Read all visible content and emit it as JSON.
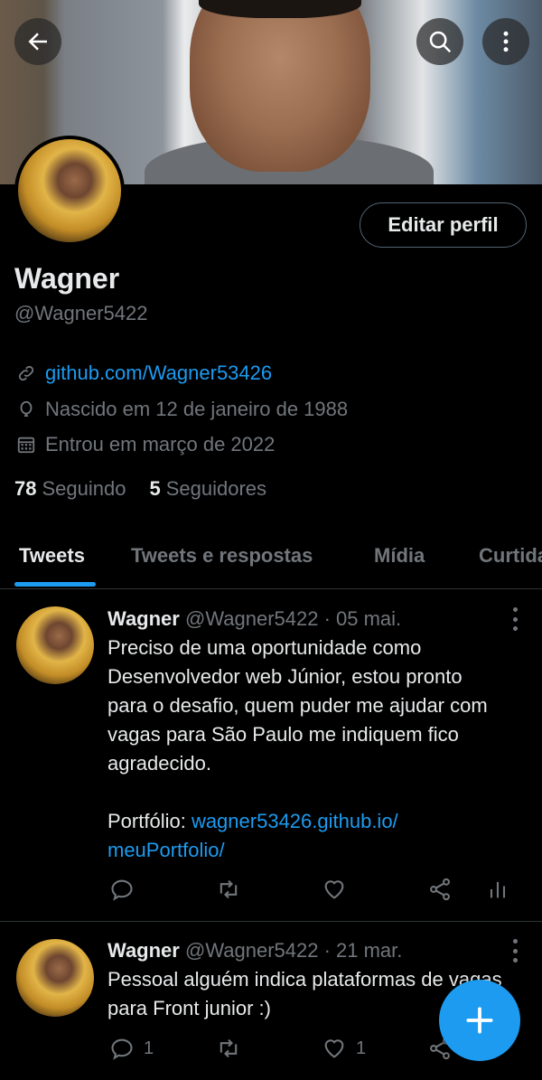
{
  "header": {
    "back_icon": "arrow-left-icon",
    "search_icon": "search-icon",
    "more_icon": "more-vertical-icon"
  },
  "profile": {
    "edit_label": "Editar perfil",
    "name": "Wagner",
    "handle": "@Wagner5422",
    "website": "github.com/Wagner53426",
    "birthday": "Nascido em 12 de janeiro de 1988",
    "joined": "Entrou em março de 2022",
    "following_count": "78",
    "following_label": "Seguindo",
    "followers_count": "5",
    "followers_label": "Seguidores"
  },
  "tabs": [
    {
      "label": "Tweets",
      "active": true
    },
    {
      "label": "Tweets e respostas",
      "active": false
    },
    {
      "label": "Mídia",
      "active": false
    },
    {
      "label": "Curtidas",
      "active": false
    }
  ],
  "tweets": [
    {
      "name": "Wagner",
      "handle_date": "@Wagner5422 · 05 mai.",
      "lines": [
        "Preciso de uma oportunidade como",
        "Desenvolvedor web Júnior, estou pronto",
        "para o desafio, quem puder me ajudar com",
        "vagas para São Paulo me indiquem fico",
        "agradecido."
      ],
      "portfolio_label": "Portfólio: ",
      "portfolio_link_1": "wagner53426.github.io/",
      "portfolio_link_2": "meuPortfolio/",
      "reply_count": "",
      "like_count": ""
    },
    {
      "name": "Wagner",
      "handle_date": "@Wagner5422 · 21 mar.",
      "lines": [
        "Pessoal alguém indica plataformas de vagas",
        "para Front junior :)"
      ],
      "reply_count": "1",
      "like_count": "1"
    }
  ],
  "colors": {
    "accent": "#1d9bf0",
    "background": "#000000",
    "muted": "#71767b",
    "text": "#e7e9ea"
  },
  "fab": {
    "icon": "plus-icon"
  }
}
